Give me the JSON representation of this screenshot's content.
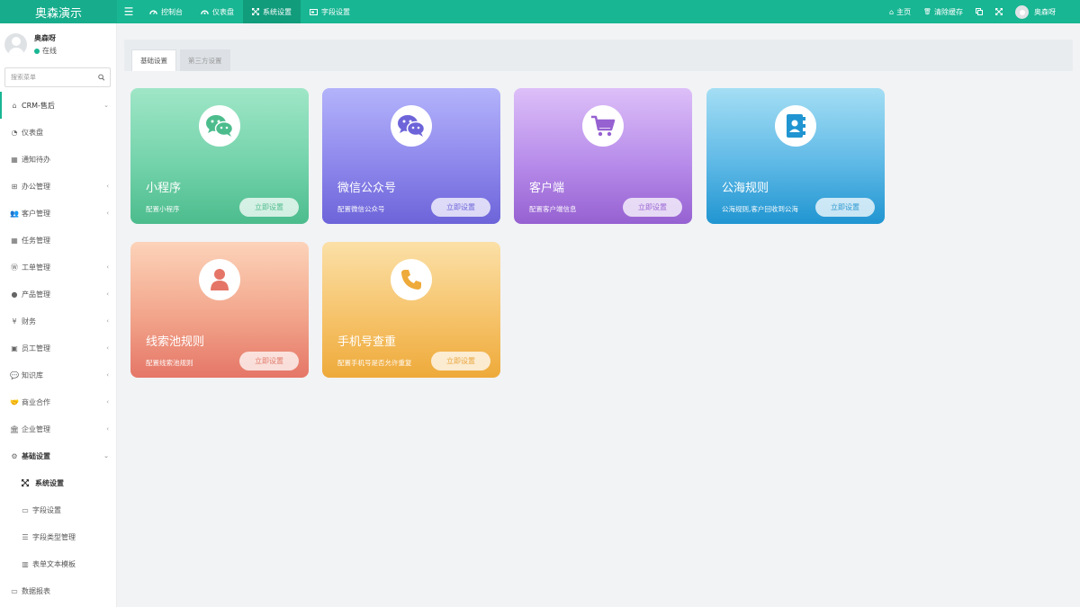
{
  "app": {
    "title": "奥森演示"
  },
  "topnav": {
    "menu_icon": "hamburger-icon",
    "items": [
      {
        "label": "控制台",
        "icon": "dashboard-icon"
      },
      {
        "label": "仪表盘",
        "icon": "gauge-icon"
      },
      {
        "label": "系统设置",
        "icon": "expand-icon",
        "active": true
      },
      {
        "label": "字段设置",
        "icon": "field-icon"
      }
    ],
    "right": {
      "home_label": "主页",
      "clear_cache_label": "清除缓存",
      "username": "奥森呀"
    }
  },
  "sidebar": {
    "user": {
      "name": "奥森呀",
      "status": "在线"
    },
    "search_placeholder": "搜索菜单",
    "menu": [
      {
        "label": "CRM-售后",
        "icon": "home-icon",
        "chevron": "⌄"
      },
      {
        "label": "仪表盘",
        "icon": "gauge-icon"
      },
      {
        "label": "通知待办",
        "icon": "calendar-icon"
      },
      {
        "label": "办公管理",
        "icon": "windows-icon",
        "chevron": "‹"
      },
      {
        "label": "客户管理",
        "icon": "users-icon",
        "chevron": "‹"
      },
      {
        "label": "任务管理",
        "icon": "calendar-icon"
      },
      {
        "label": "工单管理",
        "icon": "wordpress-icon",
        "chevron": "‹"
      },
      {
        "label": "产品管理",
        "icon": "product-icon",
        "chevron": "‹"
      },
      {
        "label": "财务",
        "icon": "yen-icon",
        "chevron": "‹"
      },
      {
        "label": "员工管理",
        "icon": "staff-icon",
        "chevron": "‹"
      },
      {
        "label": "知识库",
        "icon": "chat-icon",
        "chevron": "‹"
      },
      {
        "label": "商业合作",
        "icon": "handshake-icon",
        "chevron": "‹"
      },
      {
        "label": "企业管理",
        "icon": "bank-icon",
        "chevron": "‹"
      },
      {
        "label": "基础设置",
        "icon": "gears-icon",
        "chevron": "⌄"
      },
      {
        "label": "系统设置",
        "icon": "expand-icon"
      },
      {
        "label": "字段设置",
        "icon": "field-icon"
      },
      {
        "label": "字段类型管理",
        "icon": "list-icon"
      },
      {
        "label": "表单文本模板",
        "icon": "building-icon"
      },
      {
        "label": "数据报表",
        "icon": "laptop-icon"
      }
    ]
  },
  "tabs": [
    {
      "label": "基础设置"
    },
    {
      "label": "第三方设置"
    }
  ],
  "cards": [
    {
      "title": "小程序",
      "desc": "配置小程序",
      "button": "立即设置",
      "icon": "wechat-icon",
      "color": "#4cbc8d"
    },
    {
      "title": "微信公众号",
      "desc": "配置微信公众号",
      "button": "立即设置",
      "icon": "wechat-icon",
      "color": "#6d64d9"
    },
    {
      "title": "客户端",
      "desc": "配置客户端信息",
      "button": "立即设置",
      "icon": "cart-icon",
      "color": "#9661d1"
    },
    {
      "title": "公海规则",
      "desc": "公海规则,客户回收到公海",
      "button": "立即设置",
      "icon": "contact-book-icon",
      "color": "#2095d1"
    },
    {
      "title": "线索池规则",
      "desc": "配置线索池规则",
      "button": "立即设置",
      "icon": "user-icon",
      "color": "#e57667"
    },
    {
      "title": "手机号查重",
      "desc": "配置手机号是否允许重复",
      "button": "立即设置",
      "icon": "phone-icon",
      "color": "#eeaa3a"
    }
  ]
}
